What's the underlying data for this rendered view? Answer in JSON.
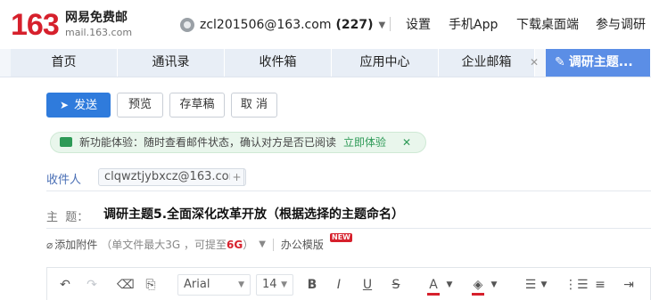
{
  "brand": {
    "logo_number": "163",
    "logo_name": "网易免费邮",
    "logo_url": "mail.163.com"
  },
  "header": {
    "account": "zcl201506@163.com",
    "unread_count": "(227)",
    "links": [
      "设置",
      "手机App",
      "下载桌面端",
      "参与调研"
    ]
  },
  "tabs": [
    {
      "label": "首页"
    },
    {
      "label": "通讯录"
    },
    {
      "label": "收件箱"
    },
    {
      "label": "应用中心"
    },
    {
      "label": "企业邮箱"
    },
    {
      "label": "调研主题..."
    }
  ],
  "compose_actions": {
    "send": "发送",
    "preview": "预览",
    "draft": "存草稿",
    "cancel": "取 消"
  },
  "notice": {
    "text": "新功能体验：随时查看邮件状态，确认对方是否已阅读",
    "link": "立即体验",
    "close": "✕"
  },
  "fields": {
    "to_label": "收件人",
    "recipient": "clqwztjybxcz@163.com",
    "add_symbol": "+",
    "subject_label": "主  题：",
    "subject_value": "调研主题5.全面深化改革开放（根据选择的主题命名）"
  },
  "attachment": {
    "add_label": "添加附件",
    "limit_prefix": "（单文件最大3G ，可提至",
    "limit_size": "6G",
    "limit_suffix": "）",
    "template_label": "办公模版",
    "new_badge": "NEW"
  },
  "editor": {
    "font_family": "Arial",
    "font_size": "14",
    "bold": "B",
    "italic": "I",
    "underline": "U",
    "strike": "S",
    "text_color_glyph": "A",
    "text_color": "#d6202c",
    "highlight_color": "#d6202c"
  },
  "colors": {
    "brand_red": "#d6202c",
    "accent_blue": "#2f7bdc",
    "active_tab": "#5b8ee6",
    "notice_green": "#2e9a57"
  }
}
